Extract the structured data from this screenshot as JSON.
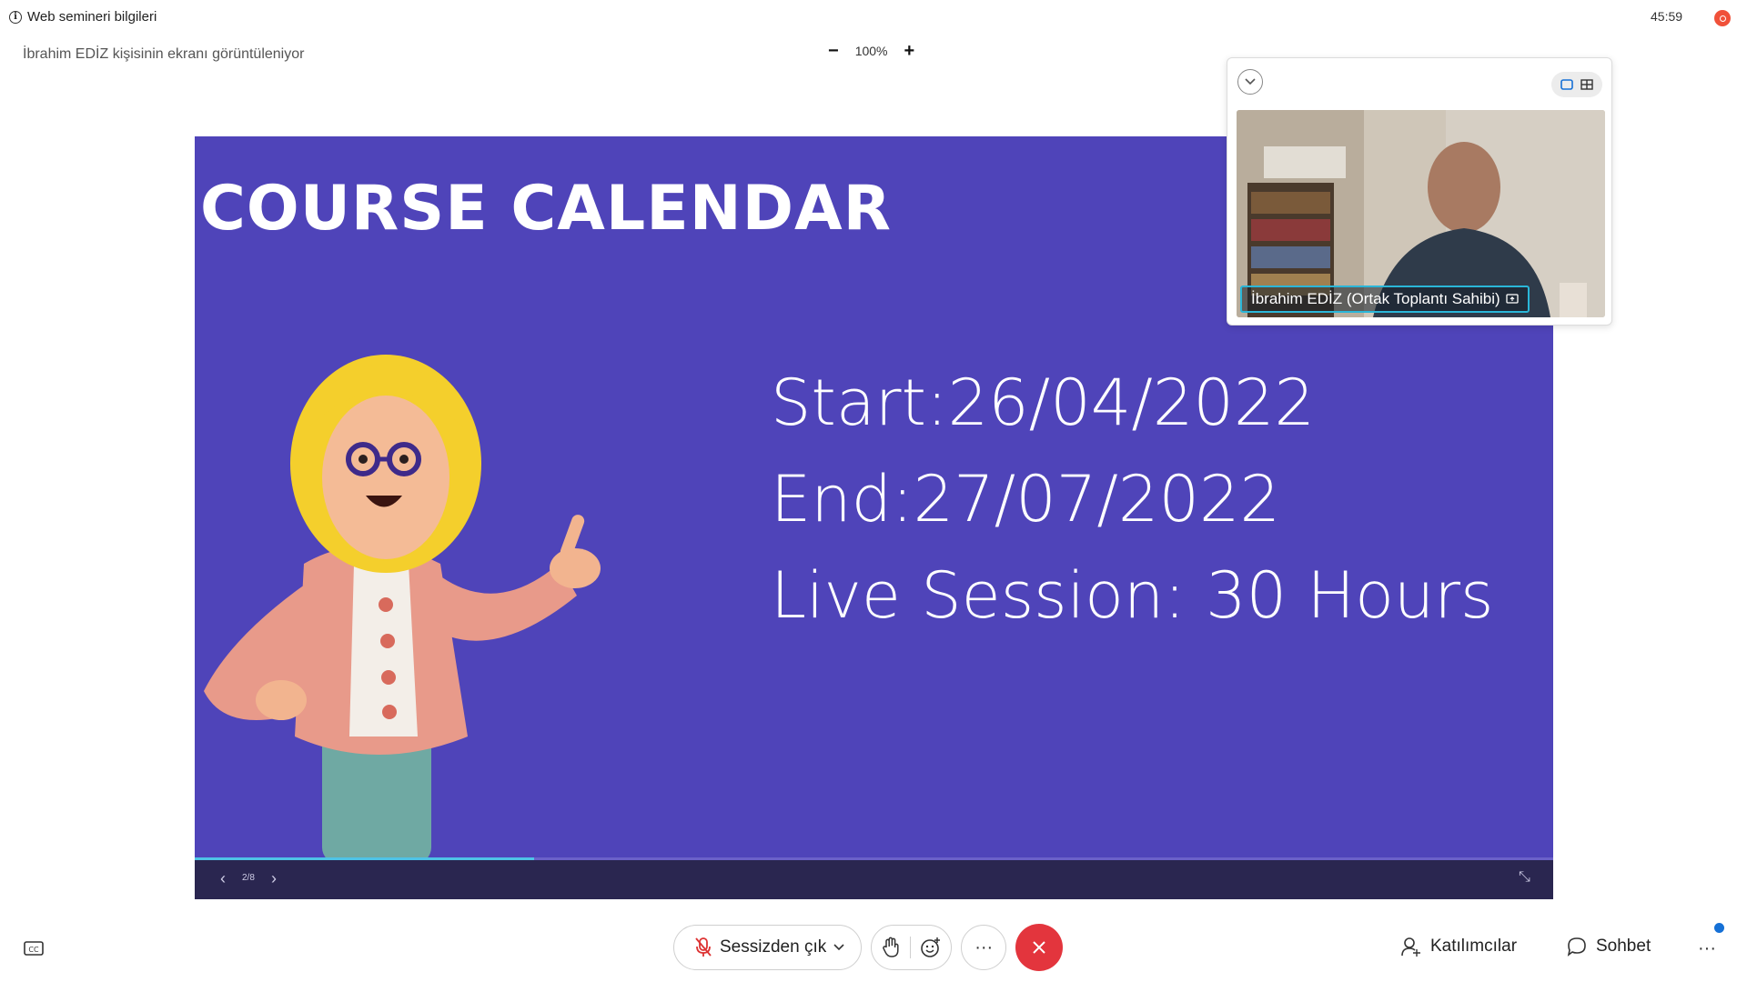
{
  "topbar": {
    "info_label": "Web semineri bilgileri",
    "timer": "45:59",
    "sharing_text": "İbrahim EDİZ kişisinin ekranı görüntüleniyor",
    "zoom_level": "100%",
    "zoom_out": "−",
    "zoom_in": "+"
  },
  "slide": {
    "title": "COURSE CALENDAR",
    "lines": [
      "Start:26/04/2022",
      "End:27/07/2022",
      "Live Session: 30 Hours"
    ],
    "page_indicator": "2/8",
    "progress": 0.25,
    "colors": {
      "background": "#4f44b9",
      "progress": "#4ec3e6"
    }
  },
  "video": {
    "participant_label": "İbrahim EDİZ (Ortak Toplantı Sahibi)"
  },
  "bottom_bar": {
    "mute_label": "Sessizden çık",
    "more_label": "···",
    "participants_label": "Katılımcılar",
    "chat_label": "Sohbet",
    "more_right_label": "···",
    "leave_color": "#e3353d"
  },
  "icons": [
    "info-icon",
    "record-icon",
    "collapse-chevron-icon",
    "single-view-icon",
    "grid-view-icon",
    "closed-caption-icon",
    "microphone-muted-icon",
    "chevron-down-icon",
    "raise-hand-icon",
    "reaction-icon",
    "close-icon",
    "participants-icon",
    "chat-icon",
    "shrink-icon",
    "screen-share-icon"
  ]
}
